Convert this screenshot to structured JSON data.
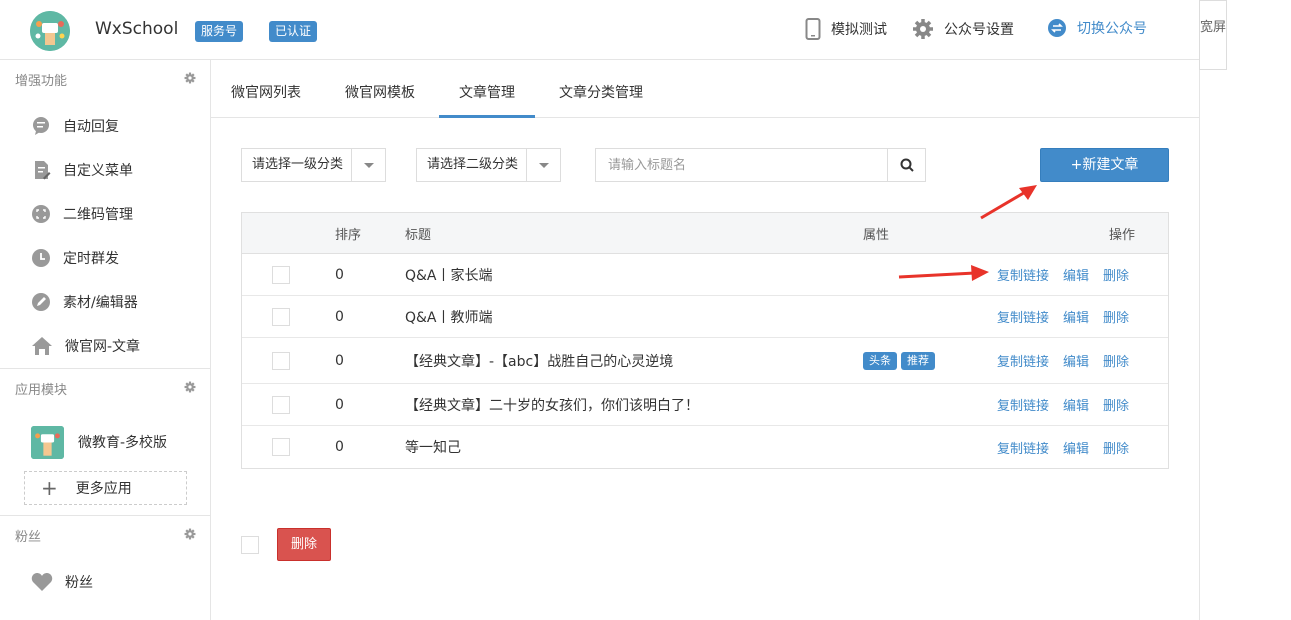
{
  "header": {
    "app_name": "WxSchool",
    "badge_service": "服务号",
    "badge_verified": "已认证",
    "sim_test": "模拟测试",
    "settings": "公众号设置",
    "switch_account": "切换公众号",
    "wide_screen": "宽屏"
  },
  "sidebar": {
    "section1": {
      "title": "增强功能",
      "items": [
        {
          "label": "自动回复",
          "icon": "chat-icon"
        },
        {
          "label": "自定义菜单",
          "icon": "edit-doc-icon"
        },
        {
          "label": "二维码管理",
          "icon": "qrcode-icon"
        },
        {
          "label": "定时群发",
          "icon": "clock-icon"
        },
        {
          "label": "素材/编辑器",
          "icon": "pencil-icon"
        },
        {
          "label": "微官网-文章",
          "icon": "home-icon"
        }
      ]
    },
    "section2": {
      "title": "应用模块",
      "app_label": "微教育-多校版",
      "more_apps": "更多应用"
    },
    "section3": {
      "title": "粉丝",
      "items": [
        {
          "label": "粉丝",
          "icon": "heart-icon"
        }
      ]
    }
  },
  "tabs": [
    "微官网列表",
    "微官网模板",
    "文章管理",
    "文章分类管理"
  ],
  "active_tab": "文章管理",
  "filters": {
    "category1": "请选择一级分类",
    "category2": "请选择二级分类",
    "search_placeholder": "请输入标题名",
    "new_article": "+新建文章"
  },
  "table": {
    "headers": {
      "order": "排序",
      "title": "标题",
      "attrs": "属性",
      "ops": "操作"
    },
    "rows": [
      {
        "order": "0",
        "title": "Q&A丨家长端",
        "tags": []
      },
      {
        "order": "0",
        "title": "Q&A丨教师端",
        "tags": []
      },
      {
        "order": "0",
        "title": "【经典文章】-【abc】战胜自己的心灵逆境",
        "tags": [
          "头条",
          "推荐"
        ]
      },
      {
        "order": "0",
        "title": "【经典文章】二十岁的女孩们，你们该明白了！",
        "tags": []
      },
      {
        "order": "0",
        "title": "等一知己",
        "tags": []
      }
    ],
    "ops": {
      "copy_link": "复制链接",
      "edit": "编辑",
      "delete": "删除"
    }
  },
  "footer": {
    "delete": "删除"
  },
  "colors": {
    "accent": "#428bca",
    "danger": "#d9534f",
    "arrow": "#e8332a"
  }
}
